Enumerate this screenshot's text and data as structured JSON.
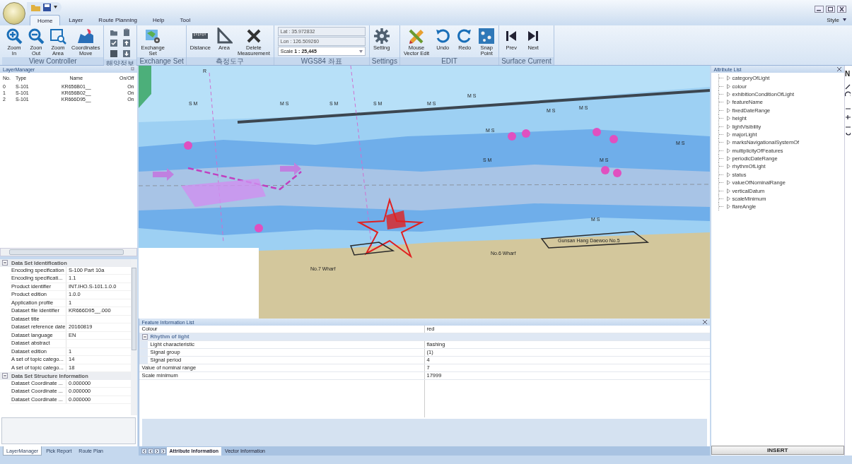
{
  "tabs": [
    {
      "label": "Home",
      "selected": true
    },
    {
      "label": "Layer",
      "selected": false
    },
    {
      "label": "Route Planning",
      "selected": false
    },
    {
      "label": "Help",
      "selected": false
    },
    {
      "label": "Tool",
      "selected": false
    }
  ],
  "style_menu": "Style",
  "ribbon_groups": [
    {
      "kind": "buttons",
      "title": "View Controller",
      "items": [
        "Zoom\nIn",
        "Zoon\nOut",
        "Zoom\nArea",
        "Coordinates\nMove"
      ]
    },
    {
      "kind": "icon_grid",
      "title": "해양정보"
    },
    {
      "kind": "buttons",
      "title": "Exchange Set",
      "items": [
        "Exchange\nSet"
      ]
    },
    {
      "kind": "buttons",
      "title": "측정도구",
      "items": [
        "Distance",
        "Area",
        "Delete\nMeasurement"
      ]
    },
    {
      "kind": "coords",
      "title": "WGS84 좌표",
      "lat": "Lat : 35.972832",
      "lon": "Lon : 126.509260",
      "scale_label": "Scale",
      "scale": "1 : 25,445"
    },
    {
      "kind": "buttons",
      "title": "Settings",
      "items": [
        "Setting"
      ]
    },
    {
      "kind": "buttons",
      "title": "EDIT",
      "items": [
        "Mouse\nVector Edit",
        "Undo",
        "Redo",
        "Snap\nPoint"
      ]
    },
    {
      "kind": "buttons",
      "title": "Surface Current",
      "items": [
        "Prev",
        "Next"
      ]
    }
  ],
  "layer_manager": {
    "title": "LayerManager",
    "columns": [
      "No.",
      "Type",
      "Name",
      "On/Off"
    ],
    "rows": [
      [
        "0",
        "S-101",
        "KR656B01__",
        "On"
      ],
      [
        "1",
        "S-101",
        "KR656B02__",
        "On"
      ],
      [
        "2",
        "S-101",
        "KR666D95__",
        "On"
      ]
    ]
  },
  "properties": [
    {
      "title": "Data Set Identification",
      "expanded": true,
      "rows": [
        {
          "name": "Encoding specification",
          "value": "S-100 Part 10a"
        },
        {
          "name": "Encoding specificati...",
          "value": "1.1"
        },
        {
          "name": "Product identifier",
          "value": "INT.IHO.S-101.1.0.0"
        },
        {
          "name": "Product edition",
          "value": "1.0.0"
        },
        {
          "name": "Application profile",
          "value": "1"
        },
        {
          "name": "Dataset file identifier",
          "value": "KR666D95__.000"
        },
        {
          "name": "Dataset title"
        },
        {
          "name": "Dataset reference date",
          "value": "20160819"
        },
        {
          "name": "Dataset language",
          "value": "EN"
        },
        {
          "name": "Dataset abstract"
        },
        {
          "name": "Dataset edition",
          "value": "1"
        },
        {
          "name": "A set of topic catego...",
          "value": "14"
        },
        {
          "name": "A set of topic catego...",
          "value": "18"
        }
      ]
    },
    {
      "title": "Data Set Structure Information",
      "expanded": true,
      "rows": [
        {
          "name": "Dataset Coordinate ...",
          "value": "0.000000"
        },
        {
          "name": "Dataset Coordinate ...",
          "value": "0.000000"
        },
        {
          "name": "Dataset Coordinate ...",
          "value": "0.000000"
        }
      ]
    }
  ],
  "left_tabs": [
    {
      "label": "LayerManager",
      "selected": true
    },
    {
      "label": "Pick Report",
      "selected": false
    },
    {
      "label": "Route Plan",
      "selected": false
    }
  ],
  "map_labels": [
    "R",
    "S M",
    "M S",
    "S M",
    "S M",
    "M S",
    "M S",
    "M S",
    "M S",
    "M S",
    "S M",
    "M S",
    "M S",
    "M S",
    "No.7 Wharf",
    "No.6 Wharf",
    "Gunsan Hang Daewoo No.5"
  ],
  "feature_info": {
    "title": "Feature Information List",
    "rows": [
      {
        "kind": "row",
        "name": "Colour",
        "value": "red"
      },
      {
        "kind": "group",
        "name": "Rhythm of light",
        "expanded": true,
        "children": [
          {
            "kind": "row",
            "name": "Light characteristic",
            "value": "flashing"
          },
          {
            "kind": "row",
            "name": "Signal group",
            "value": "(1)"
          },
          {
            "kind": "row",
            "name": "Signal period",
            "value": "4"
          }
        ]
      },
      {
        "kind": "row",
        "name": "Value of nominal range",
        "value": "7"
      },
      {
        "kind": "row",
        "name": "Scale minimum",
        "value": "17999"
      }
    ]
  },
  "doc_tabs": [
    {
      "label": "Attribute Information",
      "selected": true
    },
    {
      "label": "Vector Information",
      "selected": false
    }
  ],
  "attribute_list": {
    "title": "Attribute List",
    "items": [
      "categoryOfLight",
      "colour",
      "exhibitionConditionOfLight",
      "featureName",
      "fixedDateRange",
      "height",
      "lightVisibility",
      "majorLight",
      "marksNavigationalSystemOf",
      "multiplicityOfFeatures",
      "periodicDateRange",
      "rhythmOfLight",
      "status",
      "valueOfNominalRange",
      "verticalDatum",
      "scaleMinimum",
      "flareAngle"
    ]
  },
  "insert_button": "INSERT",
  "cut_panel_title": "N"
}
